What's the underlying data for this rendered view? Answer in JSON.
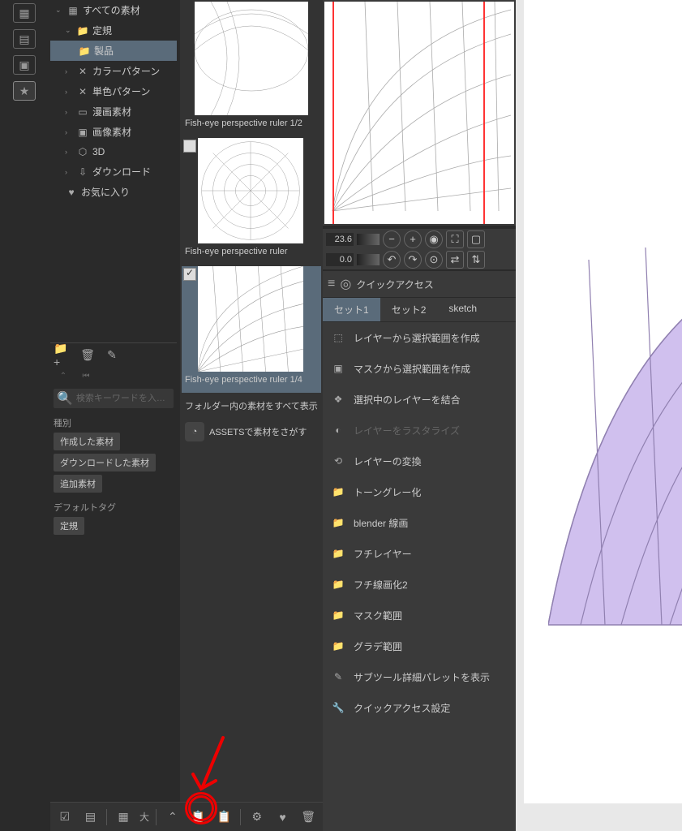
{
  "tree": {
    "root": "すべての素材",
    "items": [
      {
        "label": "定規",
        "icon": "folder",
        "depth": 1,
        "expanded": true
      },
      {
        "label": "製品",
        "icon": "folder",
        "depth": 2,
        "selected": true
      },
      {
        "label": "カラーパターン",
        "icon": "pattern",
        "depth": 1
      },
      {
        "label": "単色パターン",
        "icon": "pattern",
        "depth": 1
      },
      {
        "label": "漫画素材",
        "icon": "manga",
        "depth": 1
      },
      {
        "label": "画像素材",
        "icon": "image",
        "depth": 1
      },
      {
        "label": "3D",
        "icon": "cube",
        "depth": 1
      },
      {
        "label": "ダウンロード",
        "icon": "download",
        "depth": 1
      },
      {
        "label": "お気に入り",
        "icon": "heart",
        "depth": 1
      }
    ]
  },
  "materials": [
    {
      "label": "Fish-eye perspective ruler 1/2",
      "checked": false
    },
    {
      "label": "Fish-eye perspective ruler",
      "checked": false
    },
    {
      "label": "Fish-eye perspective ruler 1/4",
      "checked": true,
      "selected": true
    }
  ],
  "materialFooter": "フォルダー内の素材をすべて表示",
  "assetsLabel": "ASSETSで素材をさがす",
  "search": {
    "placeholder": "検索キーワードを入…"
  },
  "filters": {
    "typeLabel": "種別",
    "typeTags": [
      "作成した素材",
      "ダウンロードした素材",
      "追加素材"
    ],
    "defaultLabel": "デフォルトタグ",
    "defaultTags": [
      "定規"
    ]
  },
  "navigator": {
    "zoom": "23.6",
    "rotate": "0.0"
  },
  "quickAccess": {
    "title": "クイックアクセス",
    "tabs": [
      "セット1",
      "セット2",
      "sketch"
    ],
    "activeTab": 0,
    "items": [
      {
        "label": "レイヤーから選択範囲を作成",
        "icon": "select"
      },
      {
        "label": "マスクから選択範囲を作成",
        "icon": "mask"
      },
      {
        "label": "選択中のレイヤーを結合",
        "icon": "layers"
      },
      {
        "label": "レイヤーをラスタライズ",
        "icon": "raster",
        "disabled": true
      },
      {
        "label": "レイヤーの変換",
        "icon": "convert"
      },
      {
        "label": "トーングレー化",
        "icon": "folder"
      },
      {
        "label": "blender 線画",
        "icon": "folder"
      },
      {
        "label": "フチレイヤー",
        "icon": "folder"
      },
      {
        "label": "フチ線画化2",
        "icon": "folder"
      },
      {
        "label": "マスク範囲",
        "icon": "folder"
      },
      {
        "label": "グラデ範囲",
        "icon": "folder"
      },
      {
        "label": "サブツール詳細パレットを表示",
        "icon": "pen"
      },
      {
        "label": "クイックアクセス設定",
        "icon": "wrench"
      }
    ]
  },
  "bottomBar": {
    "sizeLabel": "大"
  },
  "colors": {
    "accent": "#5a6b7a",
    "purple": "#d0c0ee"
  }
}
